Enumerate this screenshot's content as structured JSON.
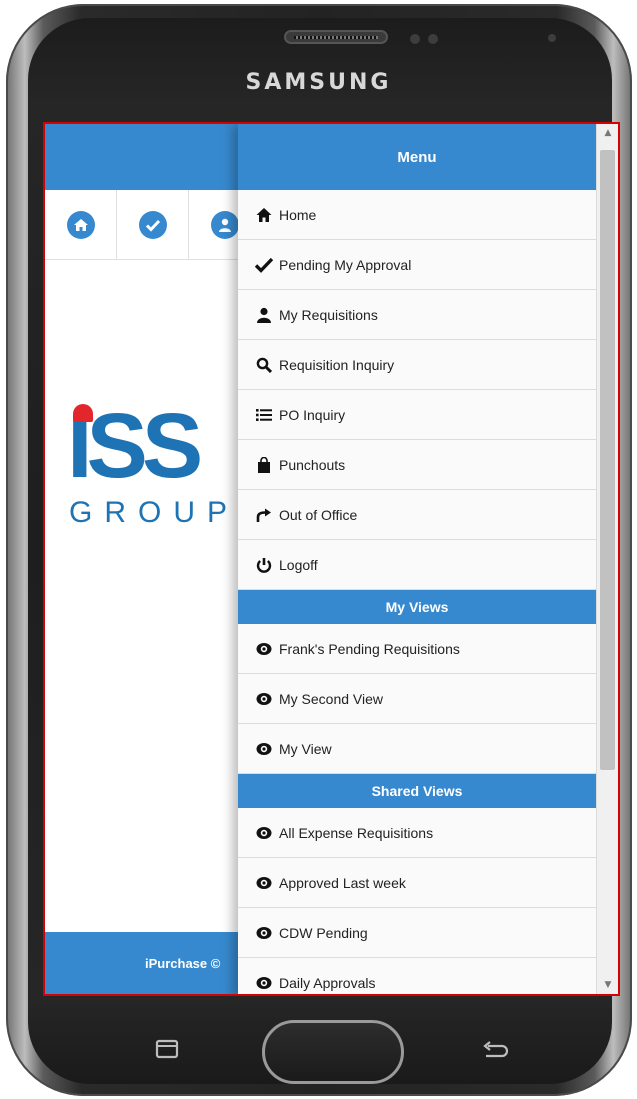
{
  "device": {
    "brand": "SAMSUNG"
  },
  "app": {
    "logo_text": "ISS",
    "logo_sub": "GROUP",
    "footer_text": "iPurchase ©",
    "nav_icons": [
      "home-icon",
      "check-icon",
      "user-icon"
    ]
  },
  "menu": {
    "title": "Menu",
    "items": [
      {
        "label": "Home",
        "icon": "home-icon"
      },
      {
        "label": "Pending My Approval",
        "icon": "check-icon"
      },
      {
        "label": "My Requisitions",
        "icon": "user-icon"
      },
      {
        "label": "Requisition Inquiry",
        "icon": "search-icon"
      },
      {
        "label": "PO Inquiry",
        "icon": "list-icon"
      },
      {
        "label": "Punchouts",
        "icon": "shopping-bag-icon"
      },
      {
        "label": "Out of Office",
        "icon": "share-arrow-icon"
      },
      {
        "label": "Logoff",
        "icon": "power-icon"
      }
    ],
    "my_views_title": "My Views",
    "my_views": [
      {
        "label": "Frank's Pending Requisitions",
        "icon": "eye-icon"
      },
      {
        "label": "My Second View",
        "icon": "eye-icon"
      },
      {
        "label": "My View",
        "icon": "eye-icon"
      }
    ],
    "shared_views_title": "Shared Views",
    "shared_views": [
      {
        "label": "All Expense Requisitions",
        "icon": "eye-icon"
      },
      {
        "label": "Approved Last week",
        "icon": "eye-icon"
      },
      {
        "label": "CDW Pending",
        "icon": "eye-icon"
      },
      {
        "label": "Daily Approvals",
        "icon": "eye-icon"
      }
    ]
  },
  "colors": {
    "accent": "#3789cf",
    "screen_border": "#d50000",
    "logo_blue": "#1e73b4",
    "logo_red": "#e2262b"
  }
}
